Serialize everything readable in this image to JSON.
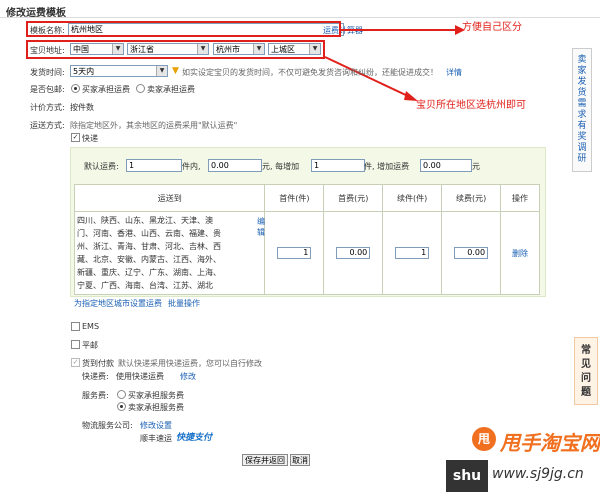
{
  "page_title": "修改运费模板",
  "fields": {
    "template_name_label": "模板名称:",
    "template_name_value": "杭州地区",
    "template_name_help": "运费计算器",
    "address_label": "宝贝地址:",
    "country": "中国",
    "province": "浙江省",
    "city": "杭州市",
    "district": "上城区",
    "ship_time_label": "发货时间:",
    "ship_time_value": "5天内",
    "ship_time_note": "如实设定宝贝的发货时间，不仅可避免发货咨询和纠纷，还能促进成交！",
    "ship_time_link": "详情",
    "free_ship_label": "是否包邮:",
    "free_opt_buyer": "买家承担运费",
    "free_opt_seller": "卖家承担运费",
    "pricing_label": "计价方式:",
    "pricing_value": "按件数",
    "method_label": "运送方式:",
    "method_note": "除指定地区外，其余地区的运费采用\"默认运费\""
  },
  "express": {
    "checkbox_label": "快递",
    "default_fee_label": "默认运费:",
    "first_count": "1",
    "unit_within": "件内,",
    "first_fee": "0.00",
    "yuan_each_add": "元,  每增加",
    "add_count": "1",
    "unit_add_fee": "件, 增加运费",
    "add_fee": "0.00",
    "yuan": "元",
    "table_headers": [
      "运送到",
      "首件(件)",
      "首费(元)",
      "续件(件)",
      "续费(元)",
      "操作"
    ],
    "row_regions": "四川、陕西、山东、黑龙江、天津、澳门、河南、香港、山西、云南、福建、贵州、浙江、青海、甘肃、河北、吉林、西藏、北京、安徽、内蒙古、江西、海外、新疆、重庆、辽宁、广东、湖南、上海、宁夏、广西、海南、台湾、江苏、湖北",
    "row_edit": "编辑",
    "row_first": "1",
    "row_first_fee": "0.00",
    "row_add": "1",
    "row_add_fee": "0.00",
    "row_delete": "删除",
    "set_city_link": "为指定地区城市设置运费",
    "batch_link": "批量操作"
  },
  "other_methods": {
    "ems": "EMS",
    "mail": "平邮"
  },
  "cod": {
    "label": "货到付款",
    "note": "默认快递采用快递运费，您可以自行修改",
    "express_fee_label": "快递费:",
    "express_fee_value": "使用快递运费",
    "express_fee_link": "修改",
    "service_label": "服务费:",
    "service_buyer": "买家承担服务费",
    "service_seller": "卖家承担服务费",
    "company_label": "物流服务公司:",
    "company_link": "修改设置",
    "company_value": "顺丰速运",
    "company_logo": "快捷支付"
  },
  "buttons": {
    "save": "保存并返回",
    "cancel": "取消"
  },
  "annotations": {
    "note1": "方便自己区分",
    "note2": "宝贝所在地区选杭州即可"
  },
  "sidebar_text": [
    "卖",
    "家",
    "发",
    "货",
    "需",
    "求",
    "有",
    "奖",
    "调",
    "研"
  ],
  "help_text": [
    "常",
    "见",
    "问",
    "题"
  ],
  "watermark_top": "甩手淘宝网",
  "watermark_bottom": "shu",
  "watermark_bottom_site": "www.sj9jg.cn",
  "colors": {
    "annotation_red": "#e0201a",
    "link_blue": "#1a5fb4",
    "panel_bg": "#f3f8e7"
  }
}
